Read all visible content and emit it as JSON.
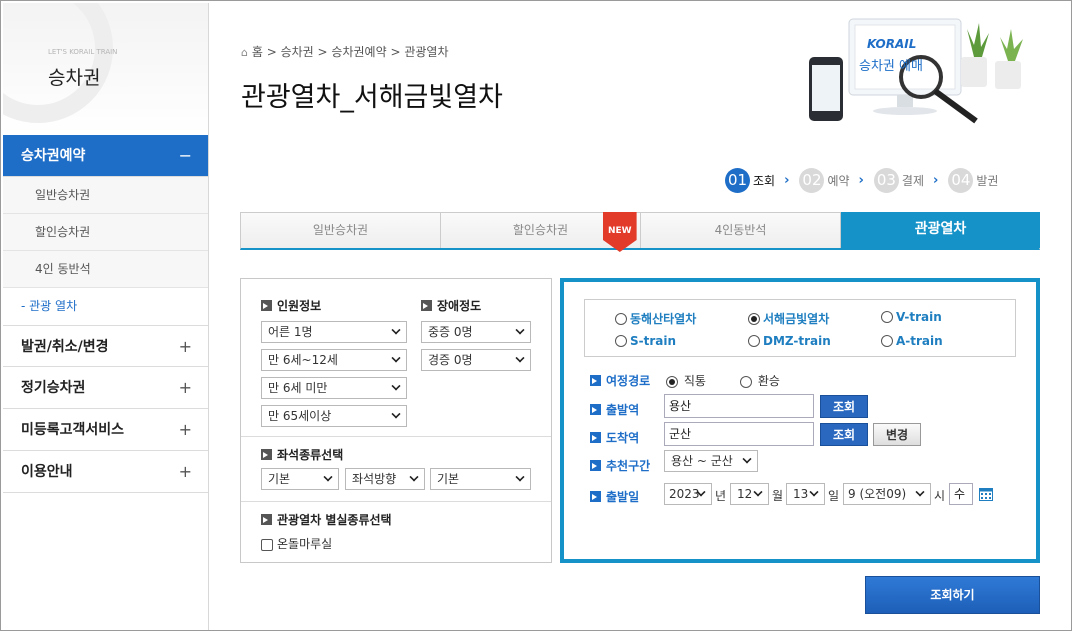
{
  "sidebar": {
    "small_caption": "LET'S KORAIL TRAIN",
    "title": "승차권",
    "items": [
      {
        "label": "승차권예약",
        "toggle": "−"
      },
      {
        "label": "발권/취소/변경",
        "toggle": "+"
      },
      {
        "label": "정기승차권",
        "toggle": "+"
      },
      {
        "label": "미등록고객서비스",
        "toggle": "+"
      },
      {
        "label": "이용안내",
        "toggle": "+"
      }
    ],
    "subitems": [
      "일반승차권",
      "할인승차권",
      "4인 동반석",
      "- 관광 열차"
    ]
  },
  "breadcrumb": {
    "home": "홈",
    "sep": ">",
    "items": [
      "승차권",
      "승차권예약",
      "관광열차"
    ]
  },
  "page_title": "관광열차_서해금빛열차",
  "banner": {
    "brand": "KORAIL",
    "text": "승차권 예매"
  },
  "steps": [
    {
      "num": "01",
      "label": "조회",
      "active": true
    },
    {
      "num": "02",
      "label": "예약",
      "active": false
    },
    {
      "num": "03",
      "label": "결제",
      "active": false
    },
    {
      "num": "04",
      "label": "발권",
      "active": false
    }
  ],
  "tabs": [
    {
      "label": "일반승차권"
    },
    {
      "label": "할인승차권",
      "badge": "NEW"
    },
    {
      "label": "4인동반석"
    },
    {
      "label": "관광열차",
      "active": true
    }
  ],
  "passengers": {
    "header": "인원정보",
    "selects": [
      "어른 1명",
      "만 6세~12세",
      "만 6세 미만",
      "만 65세이상"
    ]
  },
  "disability": {
    "header": "장애정도",
    "selects": [
      "중증 0명",
      "경증 0명"
    ]
  },
  "seat": {
    "header": "좌석종류선택",
    "selects": [
      "기본",
      "좌석방향",
      "기본"
    ]
  },
  "special": {
    "header": "관광열차 별실종류선택",
    "checkbox_label": "온돌마루실",
    "checked": false
  },
  "trains": {
    "options": [
      "동해산타열차",
      "서해금빛열차",
      "V-train",
      "S-train",
      "DMZ-train",
      "A-train"
    ],
    "selected": "서해금빛열차"
  },
  "route": {
    "label": "여정경로",
    "options": [
      "직통",
      "환승"
    ],
    "selected": "직통"
  },
  "departure": {
    "label": "출발역",
    "value": "용산",
    "button": "조회"
  },
  "arrival": {
    "label": "도착역",
    "value": "군산",
    "button": "조회",
    "swap_button": "변경"
  },
  "recommended": {
    "label": "추천구간",
    "value": "용산 ~ 군산"
  },
  "date": {
    "label": "출발일",
    "year": "2023",
    "year_unit": "년",
    "month": "12",
    "month_unit": "월",
    "day": "13",
    "day_unit": "일",
    "time": "9 (오전09)",
    "time_unit": "시",
    "weekday": "수"
  },
  "search_button": "조회하기",
  "colors": {
    "primary": "#1e6ec8",
    "tab_active": "#1593c9",
    "badge": "#e23b2a"
  }
}
